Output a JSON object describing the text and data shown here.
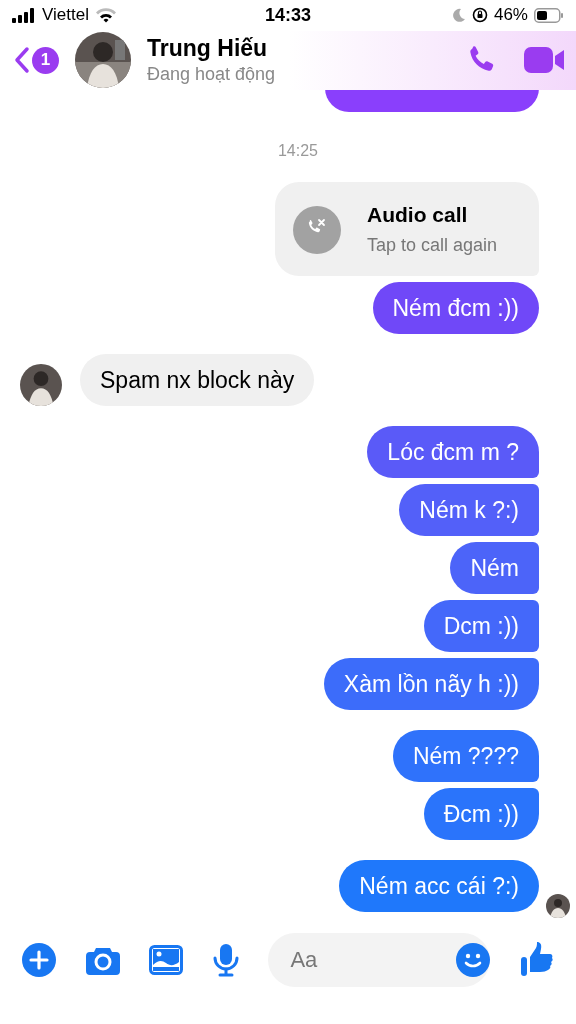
{
  "status_bar": {
    "carrier": "Viettel",
    "time": "14:33",
    "battery": "46%"
  },
  "header": {
    "back_count": "1",
    "name": "Trung Hiếu",
    "status": "Đang hoạt động"
  },
  "timestamp": "14:25",
  "call_card": {
    "title": "Audio call",
    "subtitle": "Tap to call again"
  },
  "groups": [
    {
      "kind": "sent",
      "messages": [
        {
          "text": "Ném đcm :))",
          "color": "#7048f8"
        }
      ]
    },
    {
      "kind": "received",
      "messages": [
        {
          "text": "Spam nx block này"
        }
      ]
    },
    {
      "kind": "sent",
      "messages": [
        {
          "text": "Lóc đcm m ?",
          "color": "#5a5af8"
        },
        {
          "text": "Ném k ?:)",
          "color": "#5360f9"
        },
        {
          "text": "Ném",
          "color": "#4c64f9"
        },
        {
          "text": "Dcm :))",
          "color": "#4468fa"
        },
        {
          "text": "Xàm lồn nãy h :))",
          "color": "#3c6cfa"
        }
      ]
    },
    {
      "kind": "sent",
      "messages": [
        {
          "text": "Ném ????",
          "color": "#2f72fb"
        },
        {
          "text": "Đcm :))",
          "color": "#2a74fb"
        }
      ]
    },
    {
      "kind": "sent",
      "seen": true,
      "messages": [
        {
          "text": "Ném acc cái ?:)",
          "color": "#1f78fb"
        }
      ]
    }
  ],
  "composer": {
    "placeholder": "Aa"
  }
}
